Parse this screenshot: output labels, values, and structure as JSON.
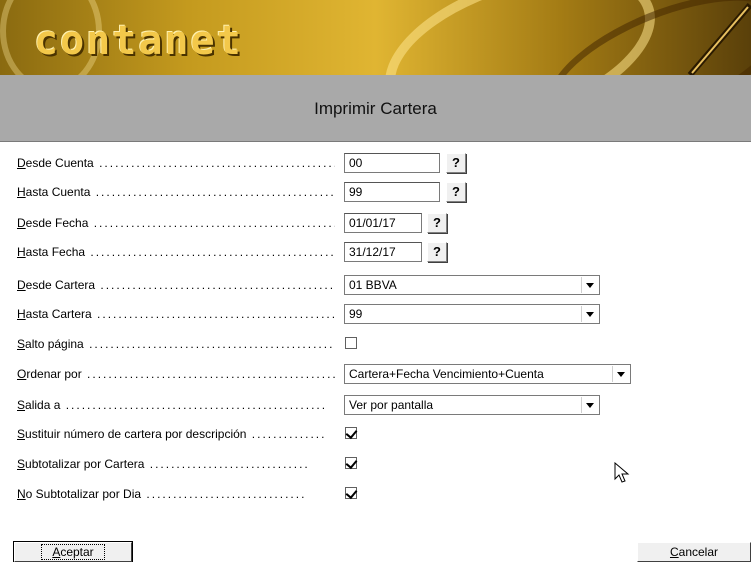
{
  "banner": {
    "logo_text": "contanet"
  },
  "dialog": {
    "title": "Imprimir Cartera"
  },
  "fields": [
    {
      "underline": "D",
      "rest": "esde Cuenta",
      "value": "00",
      "has_help": true
    },
    {
      "underline": "H",
      "rest": "asta Cuenta",
      "value": "99",
      "has_help": true
    },
    {
      "underline": "D",
      "rest": "esde Fecha",
      "value": "01/01/17",
      "has_help": true
    },
    {
      "underline": "H",
      "rest": "asta Fecha",
      "value": "31/12/17",
      "has_help": true
    },
    {
      "underline": "D",
      "rest": "esde Cartera",
      "value": "01 BBVA"
    },
    {
      "underline": "H",
      "rest": "asta Cartera",
      "value": "99"
    },
    {
      "underline": "S",
      "rest": "alto página",
      "checked": false
    },
    {
      "underline": "O",
      "rest": "rdenar por",
      "value": "Cartera+Fecha Vencimiento+Cuenta"
    },
    {
      "underline": "S",
      "rest": "alida a",
      "value": "Ver por pantalla"
    },
    {
      "underline": "S",
      "rest": "ustituir número de cartera por descripción",
      "checked": true
    },
    {
      "underline": "S",
      "rest": "ubtotalizar por Cartera",
      "checked": true
    },
    {
      "underline": "N",
      "rest": "o Subtotalizar por Dia",
      "checked": true
    }
  ],
  "help_label": "?",
  "buttons": {
    "accept": {
      "underline": "A",
      "rest": "ceptar"
    },
    "cancel": {
      "underline": "C",
      "rest": "ancelar"
    }
  }
}
